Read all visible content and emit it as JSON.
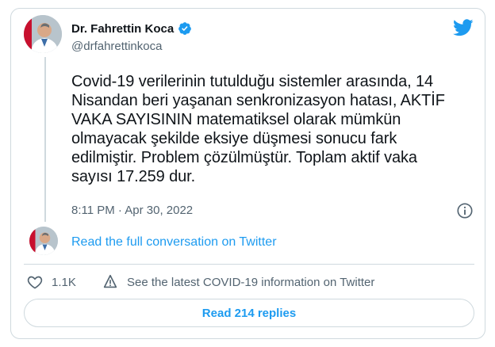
{
  "author": {
    "name": "Dr. Fahrettin Koca",
    "handle": "@drfahrettinkoca",
    "verified": true
  },
  "tweet": {
    "text": "Covid-19 verilerinin tutulduğu sistemler arasında, 14\nNisandan beri yaşanan senkronizasyon hatası, AKTİF\nVAKA SAYISININ matematiksel olarak mümkün\nolmayacak şekilde eksiye düşmesi sonucu fark\nedilmiştir. Problem çözülmüştür. Toplam aktif vaka\nsayısı 17.259 dur.",
    "timestamp": "8:11 PM · Apr 30, 2022"
  },
  "conversation_link": "Read the full conversation on Twitter",
  "actions": {
    "likes": "1.1K",
    "covid_info": "See the latest COVID-19 information on Twitter"
  },
  "replies_button": "Read 214 replies",
  "colors": {
    "accent": "#1d9bf0",
    "text": "#0f1419",
    "muted": "#536471",
    "border": "#cfd9de"
  },
  "icons": [
    "verified-badge-icon",
    "twitter-bird-icon",
    "info-icon",
    "heart-icon",
    "covid-info-icon"
  ]
}
